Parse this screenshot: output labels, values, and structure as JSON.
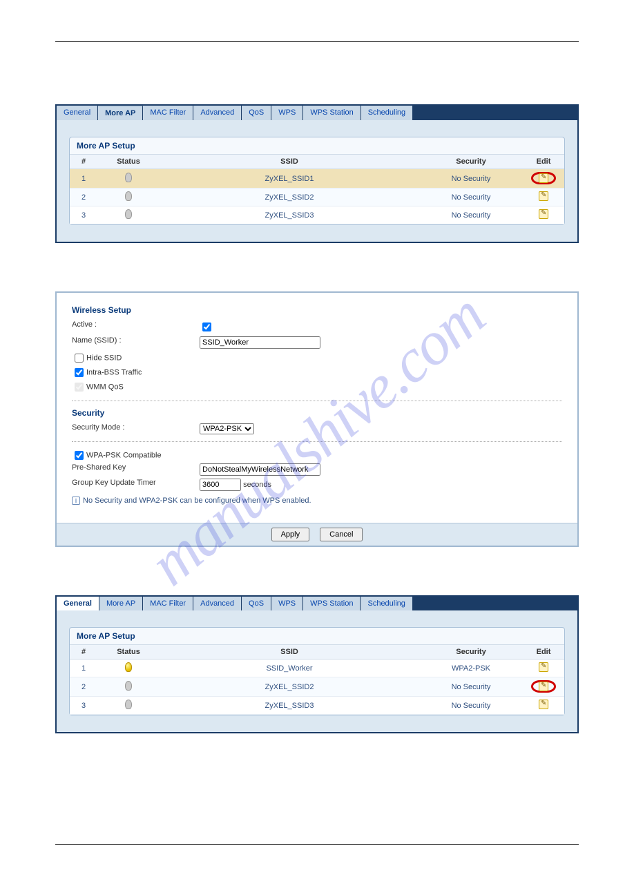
{
  "watermark": "manualshive.com",
  "panel1": {
    "tabs": [
      "General",
      "More AP",
      "MAC Filter",
      "Advanced",
      "QoS",
      "WPS",
      "WPS Station",
      "Scheduling"
    ],
    "active_idx": 1,
    "card_title": "More AP Setup",
    "headers": {
      "num": "#",
      "status": "Status",
      "ssid": "SSID",
      "security": "Security",
      "edit": "Edit"
    },
    "rows": [
      {
        "num": "1",
        "active": false,
        "ssid": "ZyXEL_SSID1",
        "security": "No Security",
        "circled": true,
        "highlighted": true
      },
      {
        "num": "2",
        "active": false,
        "ssid": "ZyXEL_SSID2",
        "security": "No Security",
        "circled": false,
        "highlighted": false
      },
      {
        "num": "3",
        "active": false,
        "ssid": "ZyXEL_SSID3",
        "security": "No Security",
        "circled": false,
        "highlighted": false
      }
    ]
  },
  "panel2": {
    "section_wireless": "Wireless Setup",
    "labels": {
      "active": "Active :",
      "name": "Name (SSID) :",
      "hide": "Hide SSID",
      "intra": "Intra-BSS Traffic",
      "wmm": "WMM QoS",
      "security_mode": "Security Mode :",
      "wpa_compat": "WPA-PSK Compatible",
      "psk": "Pre-Shared Key",
      "timer": "Group Key Update Timer",
      "seconds": "seconds"
    },
    "values": {
      "active": true,
      "name": "SSID_Worker",
      "hide": false,
      "intra": true,
      "wmm": true,
      "wpa_compat": true,
      "psk": "DoNotStealMyWirelessNetwork",
      "timer": "3600",
      "mode": "WPA2-PSK"
    },
    "section_security": "Security",
    "note_text": "No Security and WPA2-PSK can be configured when WPS enabled.",
    "buttons": {
      "apply": "Apply",
      "cancel": "Cancel"
    }
  },
  "panel3": {
    "tabs": [
      "General",
      "More AP",
      "MAC Filter",
      "Advanced",
      "QoS",
      "WPS",
      "WPS Station",
      "Scheduling"
    ],
    "active_idx": 0,
    "card_title": "More AP Setup",
    "headers": {
      "num": "#",
      "status": "Status",
      "ssid": "SSID",
      "security": "Security",
      "edit": "Edit"
    },
    "rows": [
      {
        "num": "1",
        "active": true,
        "ssid": "SSID_Worker",
        "security": "WPA2-PSK",
        "circled": false,
        "highlighted": false
      },
      {
        "num": "2",
        "active": false,
        "ssid": "ZyXEL_SSID2",
        "security": "No Security",
        "circled": true,
        "highlighted": false
      },
      {
        "num": "3",
        "active": false,
        "ssid": "ZyXEL_SSID3",
        "security": "No Security",
        "circled": false,
        "highlighted": false
      }
    ]
  }
}
